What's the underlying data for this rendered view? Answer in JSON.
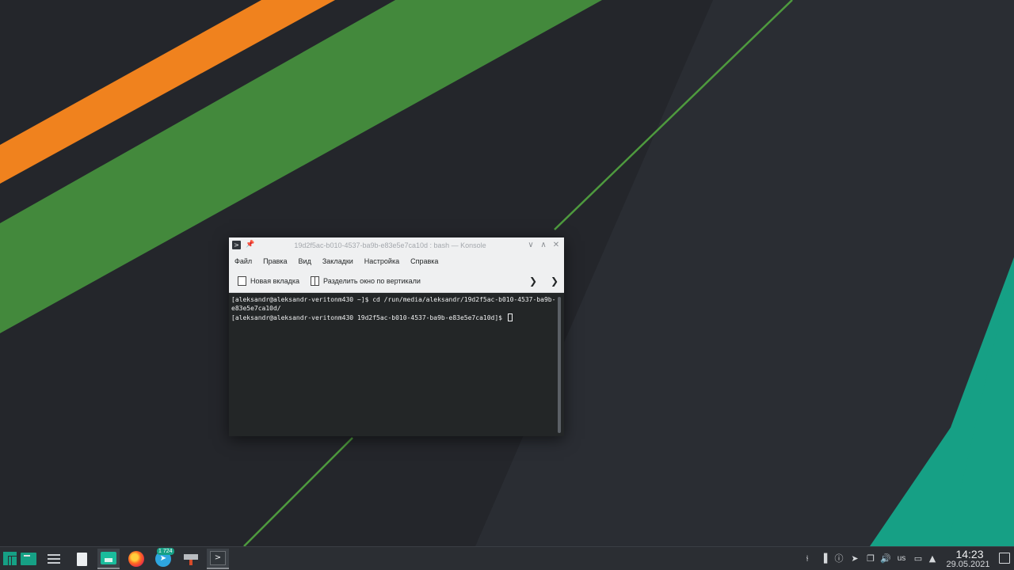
{
  "wallpaper": {
    "colors": {
      "background": "#24262b",
      "orange": "#f0821e",
      "green": "#43893c",
      "teal": "#16a085",
      "line": "#4e9a3e"
    }
  },
  "window": {
    "title": "19d2f5ac-b010-4537-ba9b-e83e5e7ca10d : bash — Konsole",
    "menu": [
      "Файл",
      "Правка",
      "Вид",
      "Закладки",
      "Настройка",
      "Справка"
    ],
    "toolbar": {
      "new_tab": "Новая вкладка",
      "split": "Разделить окно по вертикали"
    },
    "terminal_lines": [
      "[aleksandr@aleksandr-veritonm430 ~]$ cd /run/media/aleksandr/19d2f5ac-b010-4537-ba9b-e83e5e7ca10d/",
      "[aleksandr@aleksandr-veritonm430 19d2f5ac-b010-4537-ba9b-e83e5e7ca10d]$ "
    ]
  },
  "taskbar": {
    "telegram_badge": "1 724",
    "keyboard_layout": "us",
    "time": "14:23",
    "date": "29.05.2021",
    "icons": [
      "manjaro-menu-icon",
      "desktop-pager-icon",
      "system-settings-icon",
      "text-file-icon",
      "file-manager-icon",
      "firefox-icon",
      "telegram-icon",
      "stamp-app-icon",
      "konsole-icon"
    ],
    "tray_icons": [
      "network-icon",
      "manjaro-settings-icon",
      "updates-icon",
      "telegram-tray-icon",
      "clipboard-icon",
      "volume-icon",
      "keyboard-layout-indicator",
      "display-icon",
      "tray-expand-icon"
    ]
  }
}
